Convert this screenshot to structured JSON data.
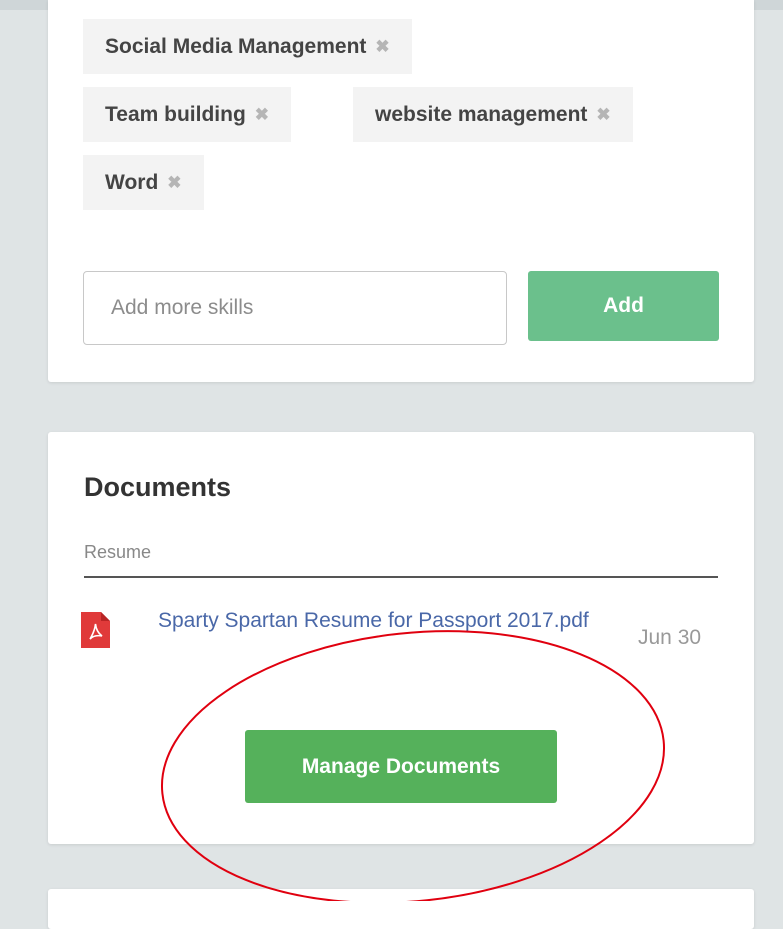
{
  "skills": {
    "tags": [
      {
        "label": "Social Media Management",
        "remove_glyph": "✖"
      },
      {
        "label": "Team building",
        "remove_glyph": "✖"
      },
      {
        "label": "website management",
        "remove_glyph": "✖"
      },
      {
        "label": "Word",
        "remove_glyph": "✖"
      }
    ],
    "input_placeholder": "Add more skills",
    "add_label": "Add"
  },
  "documents": {
    "title": "Documents",
    "section_label": "Resume",
    "files": [
      {
        "name": "Sparty Spartan Resume for Passport 2017.pdf",
        "date": "Jun 30",
        "icon": "pdf-file-icon"
      }
    ],
    "manage_label": "Manage Documents"
  },
  "colors": {
    "add_button": "#6bc08c",
    "manage_button": "#55b15b",
    "link": "#4a68a8",
    "annotation_circle": "#e0000f",
    "pdf_icon": "#e03a3a"
  }
}
